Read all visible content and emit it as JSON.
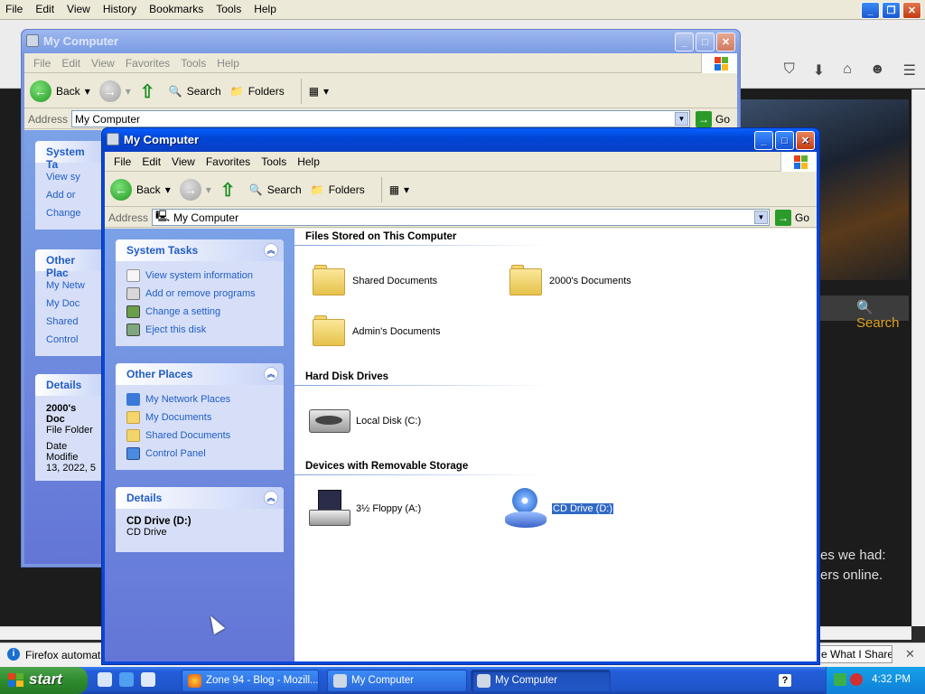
{
  "firefox": {
    "menu": [
      "File",
      "Edit",
      "View",
      "History",
      "Bookmarks",
      "Tools",
      "Help"
    ],
    "search_label": "Search",
    "page_text_1": "es we had:",
    "page_text_2": "ers online.",
    "notification": "Firefox automatio",
    "share_button": "e What I Share",
    "nav_icons": [
      "pocket-icon",
      "download-icon",
      "home-icon",
      "chat-icon",
      "menu-icon"
    ]
  },
  "back_window": {
    "title": "My Computer",
    "menu": [
      "File",
      "Edit",
      "View",
      "Favorites",
      "Tools",
      "Help"
    ],
    "back": "Back",
    "search": "Search",
    "folders": "Folders",
    "address_label": "Address",
    "address_value": "My Computer",
    "go": "Go",
    "system_tasks": "System Ta",
    "tasks": [
      "View sy",
      "Add or",
      "Change"
    ],
    "other_places": "Other Plac",
    "places": [
      "My Netw",
      "My Doc",
      "Shared",
      "Control"
    ],
    "details": "Details",
    "detail_name": "2000's Doc",
    "detail_type": "File Folder",
    "detail_date1": "Date Modifie",
    "detail_date2": "13, 2022, 5"
  },
  "window": {
    "title": "My Computer",
    "menu": [
      "File",
      "Edit",
      "View",
      "Favorites",
      "Tools",
      "Help"
    ],
    "back": "Back",
    "search": "Search",
    "folders": "Folders",
    "address_label": "Address",
    "address_value": "My Computer",
    "go": "Go",
    "system_tasks": {
      "title": "System Tasks",
      "items": [
        "View system information",
        "Add or remove programs",
        "Change a setting",
        "Eject this disk"
      ]
    },
    "other_places": {
      "title": "Other Places",
      "items": [
        "My Network Places",
        "My Documents",
        "Shared Documents",
        "Control Panel"
      ]
    },
    "details": {
      "title": "Details",
      "name": "CD Drive (D:)",
      "type": "CD Drive"
    },
    "groups": {
      "files": "Files Stored on This Computer",
      "hdd": "Hard Disk Drives",
      "removable": "Devices with Removable Storage"
    },
    "items": {
      "shared_docs": "Shared Documents",
      "docs_2000": "2000's Documents",
      "admin_docs": "Admin's Documents",
      "local_disk": "Local Disk (C:)",
      "floppy": "3½ Floppy (A:)",
      "cd": "CD Drive (D:)"
    }
  },
  "taskbar": {
    "start": "start",
    "buttons": [
      "Zone 94 - Blog - Mozill...",
      "My Computer",
      "My Computer"
    ],
    "clock": "4:32 PM"
  }
}
